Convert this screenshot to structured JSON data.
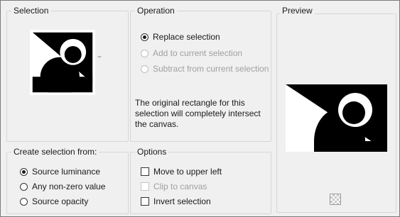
{
  "selection": {
    "title": "Selection",
    "dropdown_icon": "chevron-down-icon"
  },
  "operation": {
    "title": "Operation",
    "options": [
      {
        "label": "Replace selection",
        "selected": true,
        "enabled": true
      },
      {
        "label": "Add to current selection",
        "selected": false,
        "enabled": false
      },
      {
        "label": "Subtract from current selection",
        "selected": false,
        "enabled": false
      }
    ],
    "note_lines": [
      "The original rectangle for this",
      "selection will completely intersect",
      "the canvas."
    ]
  },
  "preview": {
    "title": "Preview",
    "transparency_icon": "checkerboard-icon"
  },
  "create_from": {
    "title": "Create selection from:",
    "options": [
      {
        "label": "Source luminance",
        "selected": true
      },
      {
        "label": "Any non-zero value",
        "selected": false
      },
      {
        "label": "Source opacity",
        "selected": false
      }
    ]
  },
  "options": {
    "title": "Options",
    "checkboxes": [
      {
        "label": "Move to upper left",
        "checked": false,
        "enabled": true
      },
      {
        "label": "Clip to canvas",
        "checked": false,
        "enabled": false
      },
      {
        "label": "Invert selection",
        "checked": false,
        "enabled": true
      }
    ]
  },
  "colors": {
    "panel": "#f0f0f0",
    "border": "#d6d6d6",
    "disabled": "#a0a0a0"
  }
}
